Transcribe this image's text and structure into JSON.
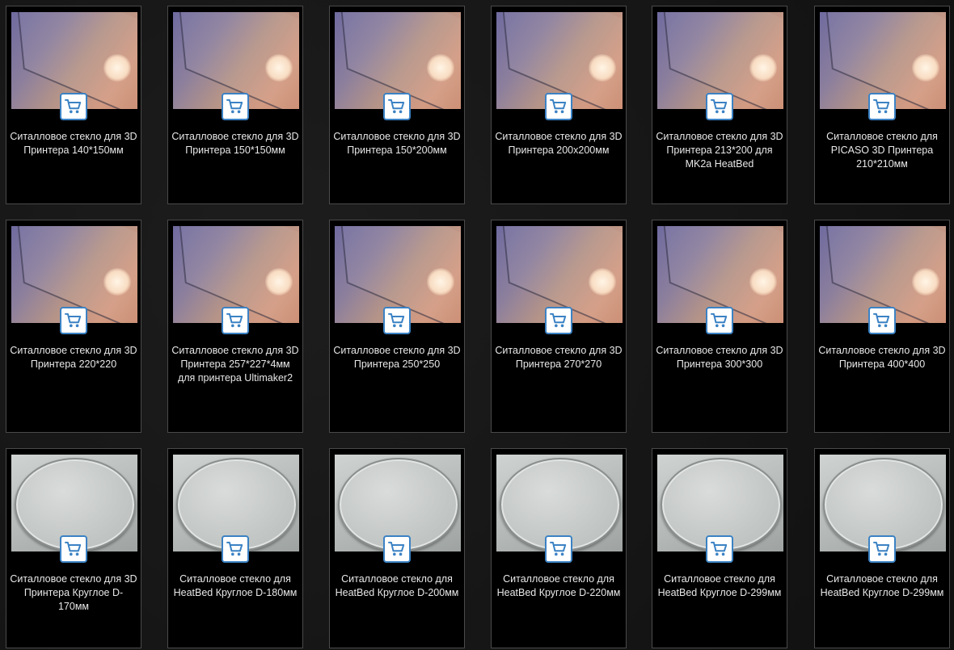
{
  "cart_icon": "shopping-cart-icon",
  "accent_color": "#3b82c4",
  "products": [
    {
      "title": "Ситалловое стекло для 3D Принтера 140*150мм",
      "image": "square-glass"
    },
    {
      "title": "Ситалловое стекло для 3D Принтера 150*150мм",
      "image": "square-glass"
    },
    {
      "title": "Ситалловое стекло для 3D Принтера 150*200мм",
      "image": "square-glass"
    },
    {
      "title": "Ситалловое стекло для 3D Принтера 200х200мм",
      "image": "square-glass"
    },
    {
      "title": "Ситалловое стекло для 3D Принтера 213*200 для MK2a HeatBed",
      "image": "square-glass"
    },
    {
      "title": "Ситалловое стекло для PICASO 3D Принтера 210*210мм",
      "image": "square-glass"
    },
    {
      "title": "Ситалловое стекло для 3D Принтера 220*220",
      "image": "square-glass"
    },
    {
      "title": "Ситалловое стекло для 3D Принтера 257*227*4мм для принтера Ultimaker2",
      "image": "square-glass"
    },
    {
      "title": "Ситалловое стекло для 3D Принтера 250*250",
      "image": "square-glass"
    },
    {
      "title": "Ситалловое стекло для 3D Принтера 270*270",
      "image": "square-glass"
    },
    {
      "title": "Ситалловое стекло для 3D Принтера 300*300",
      "image": "square-glass"
    },
    {
      "title": "Ситалловое стекло для 3D Принтера 400*400",
      "image": "square-glass"
    },
    {
      "title": "Ситалловое стекло для 3D Принтера Круглое D-170мм",
      "image": "round-glass"
    },
    {
      "title": "Ситалловое стекло для HeatBed Круглое D-180мм",
      "image": "round-glass"
    },
    {
      "title": "Ситалловое стекло для HeatBed Круглое D-200мм",
      "image": "round-glass"
    },
    {
      "title": "Ситалловое стекло для HeatBed Круглое D-220мм",
      "image": "round-glass"
    },
    {
      "title": "Ситалловое стекло для HeatBed Круглое D-299мм",
      "image": "round-glass"
    },
    {
      "title": "Ситалловое стекло для HeatBed Круглое D-299мм",
      "image": "round-glass"
    }
  ]
}
